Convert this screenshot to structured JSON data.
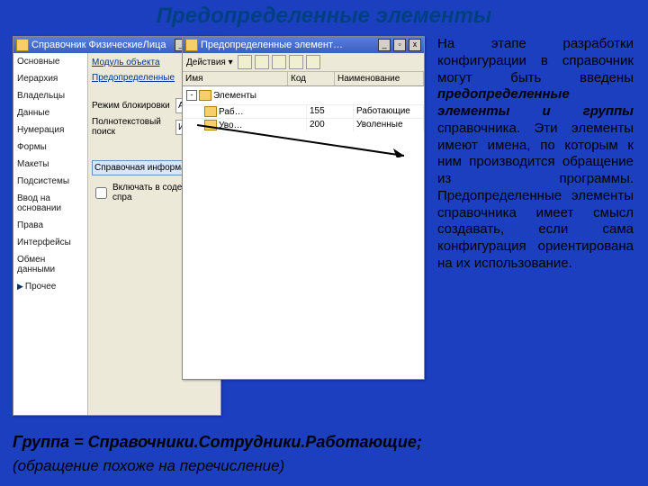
{
  "title": "Предопределенные элементы",
  "win1": {
    "title": "Справочник ФизическиеЛица",
    "side": [
      "Основные",
      "Иерархия",
      "Владельцы",
      "Данные",
      "Нумерация",
      "Формы",
      "Макеты",
      "Подсистемы",
      "Ввод на основании",
      "Права",
      "Интерфейсы",
      "Обмен данными",
      "Прочее"
    ],
    "more": "▶ Прочее",
    "links": [
      "Модуль объекта",
      "Предопределенные"
    ],
    "rows": {
      "r1_label": "Режим блокировки",
      "r1_val": "Авт",
      "r2_label": "Полнотекстовый поиск",
      "r2_val": "Исп"
    },
    "sec": "Справочная информация",
    "chk": "Включать в содержание спра"
  },
  "win2": {
    "title": "Предопределенные элемент…",
    "actions": "Действия ▾",
    "headers": {
      "c1": "Имя",
      "c2": "Код",
      "c3": "Наименование"
    },
    "root": "Элементы",
    "row1": {
      "name": "Раб…",
      "code": "155",
      "descr": "Работающие"
    },
    "row2": {
      "name": "Уво…",
      "code": "200",
      "descr": "Уволенные"
    }
  },
  "text": {
    "p1": "На этапе разработки конфигурации в справочник могут быть введены ",
    "em": "предопределенные элементы и группы",
    "p2": " справочника. Эти элементы имеют имена, по которым к ним производится обращение из программы. Предопределенные элементы справочника имеет смысл создавать, если сама конфигурация ориентирована на их использование."
  },
  "foot1": "Группа = Справочники.Сотрудники.Работающие;",
  "foot2": "(обращение похоже на перечисление)"
}
